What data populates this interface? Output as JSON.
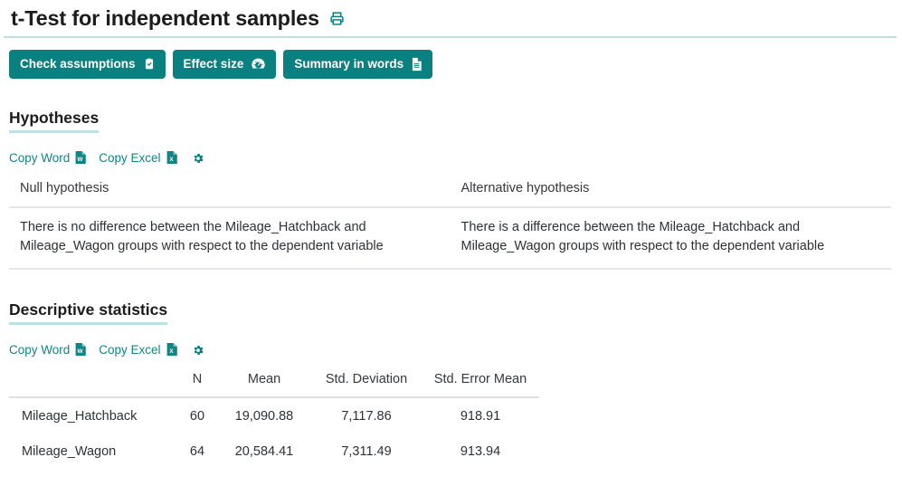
{
  "header": {
    "title": "t-Test for independent samples",
    "print_icon": "print-icon"
  },
  "actions": [
    {
      "label": "Check assumptions",
      "icon": "clipboard-check-icon"
    },
    {
      "label": "Effect size",
      "icon": "gauge-icon"
    },
    {
      "label": "Summary in words",
      "icon": "document-text-icon"
    }
  ],
  "sections": {
    "hypotheses": {
      "heading": "Hypotheses",
      "copy_word": "Copy Word",
      "copy_excel": "Copy Excel",
      "settings_icon": "gear-icon",
      "columns": [
        "Null hypothesis",
        "Alternative hypothesis"
      ],
      "row": [
        "There is no difference between the Mileage_Hatchback and Mileage_Wagon groups with respect to the dependent variable",
        "There is a difference between the Mileage_Hatchback and Mileage_Wagon groups with respect to the dependent variable"
      ]
    },
    "descriptive": {
      "heading": "Descriptive statistics",
      "copy_word": "Copy Word",
      "copy_excel": "Copy Excel",
      "settings_icon": "gear-icon",
      "columns": [
        "",
        "N",
        "Mean",
        "Std. Deviation",
        "Std. Error Mean"
      ],
      "rows": [
        {
          "group": "Mileage_Hatchback",
          "n": "60",
          "mean": "19,090.88",
          "sd": "7,117.86",
          "sem": "918.91"
        },
        {
          "group": "Mileage_Wagon",
          "n": "64",
          "mean": "20,584.41",
          "sd": "7,311.49",
          "sem": "913.94"
        }
      ]
    }
  },
  "colors": {
    "teal": "#0a8080",
    "teal_link": "#0f8686",
    "teal_underline": "#bfe0e0",
    "table_border": "#e3e6e8",
    "text": "#2b3238"
  }
}
